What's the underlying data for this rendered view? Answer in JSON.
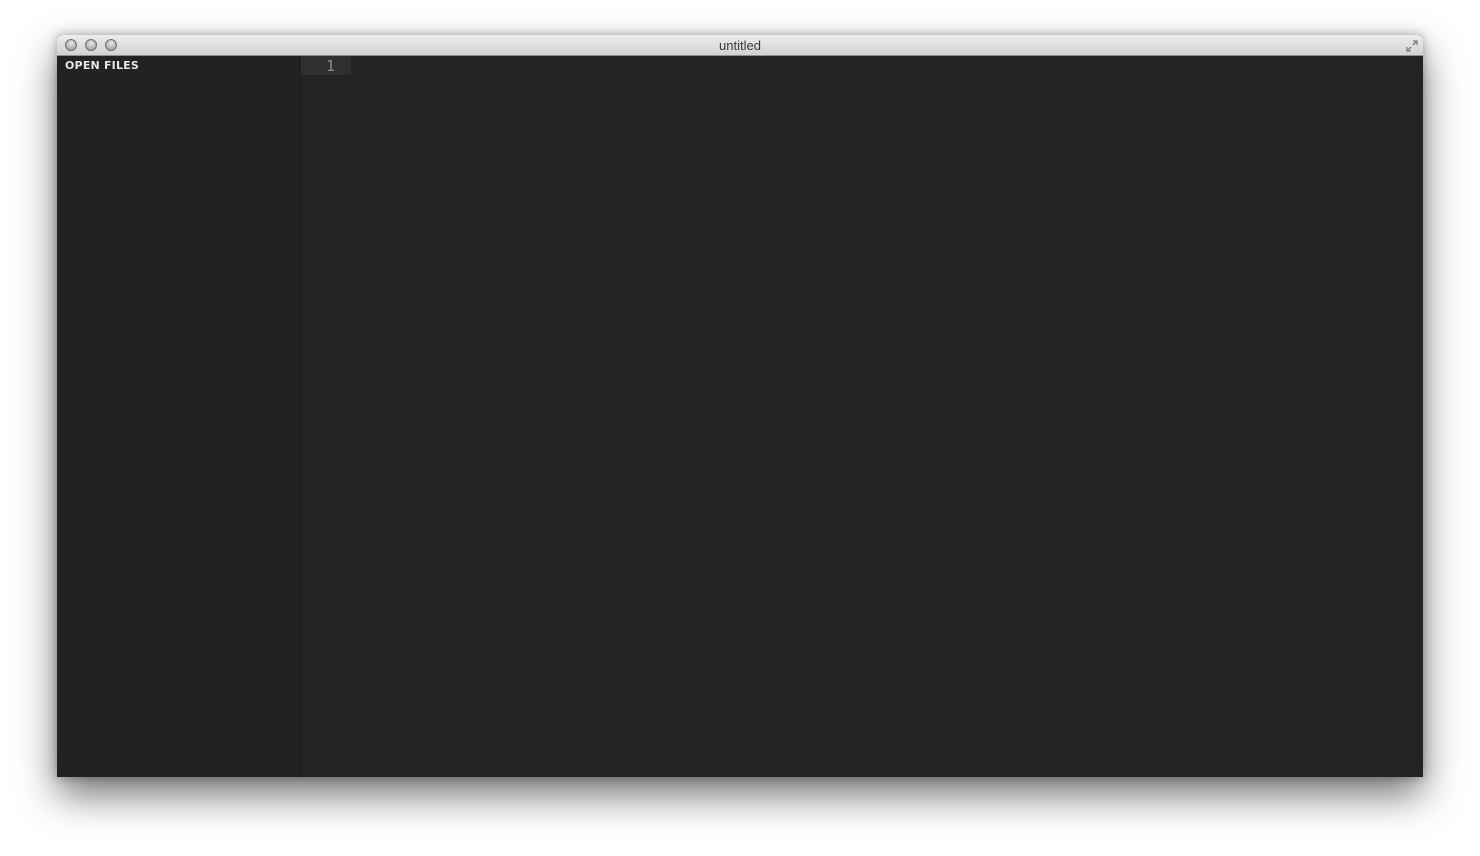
{
  "window": {
    "title": "untitled"
  },
  "titlebar": {
    "buttons": [
      "close",
      "minimize",
      "zoom"
    ],
    "fullscreen_icon": "fullscreen-arrows-icon"
  },
  "sidebar": {
    "header": "OPEN FILES",
    "items": []
  },
  "editor": {
    "line_numbers": [
      "1"
    ],
    "content": ""
  },
  "colors": {
    "editor_bg": "#232323",
    "sidebar_bg": "#222222",
    "titlebar_bg": "#dedede",
    "active_line_gutter": "#2f2f2f"
  }
}
